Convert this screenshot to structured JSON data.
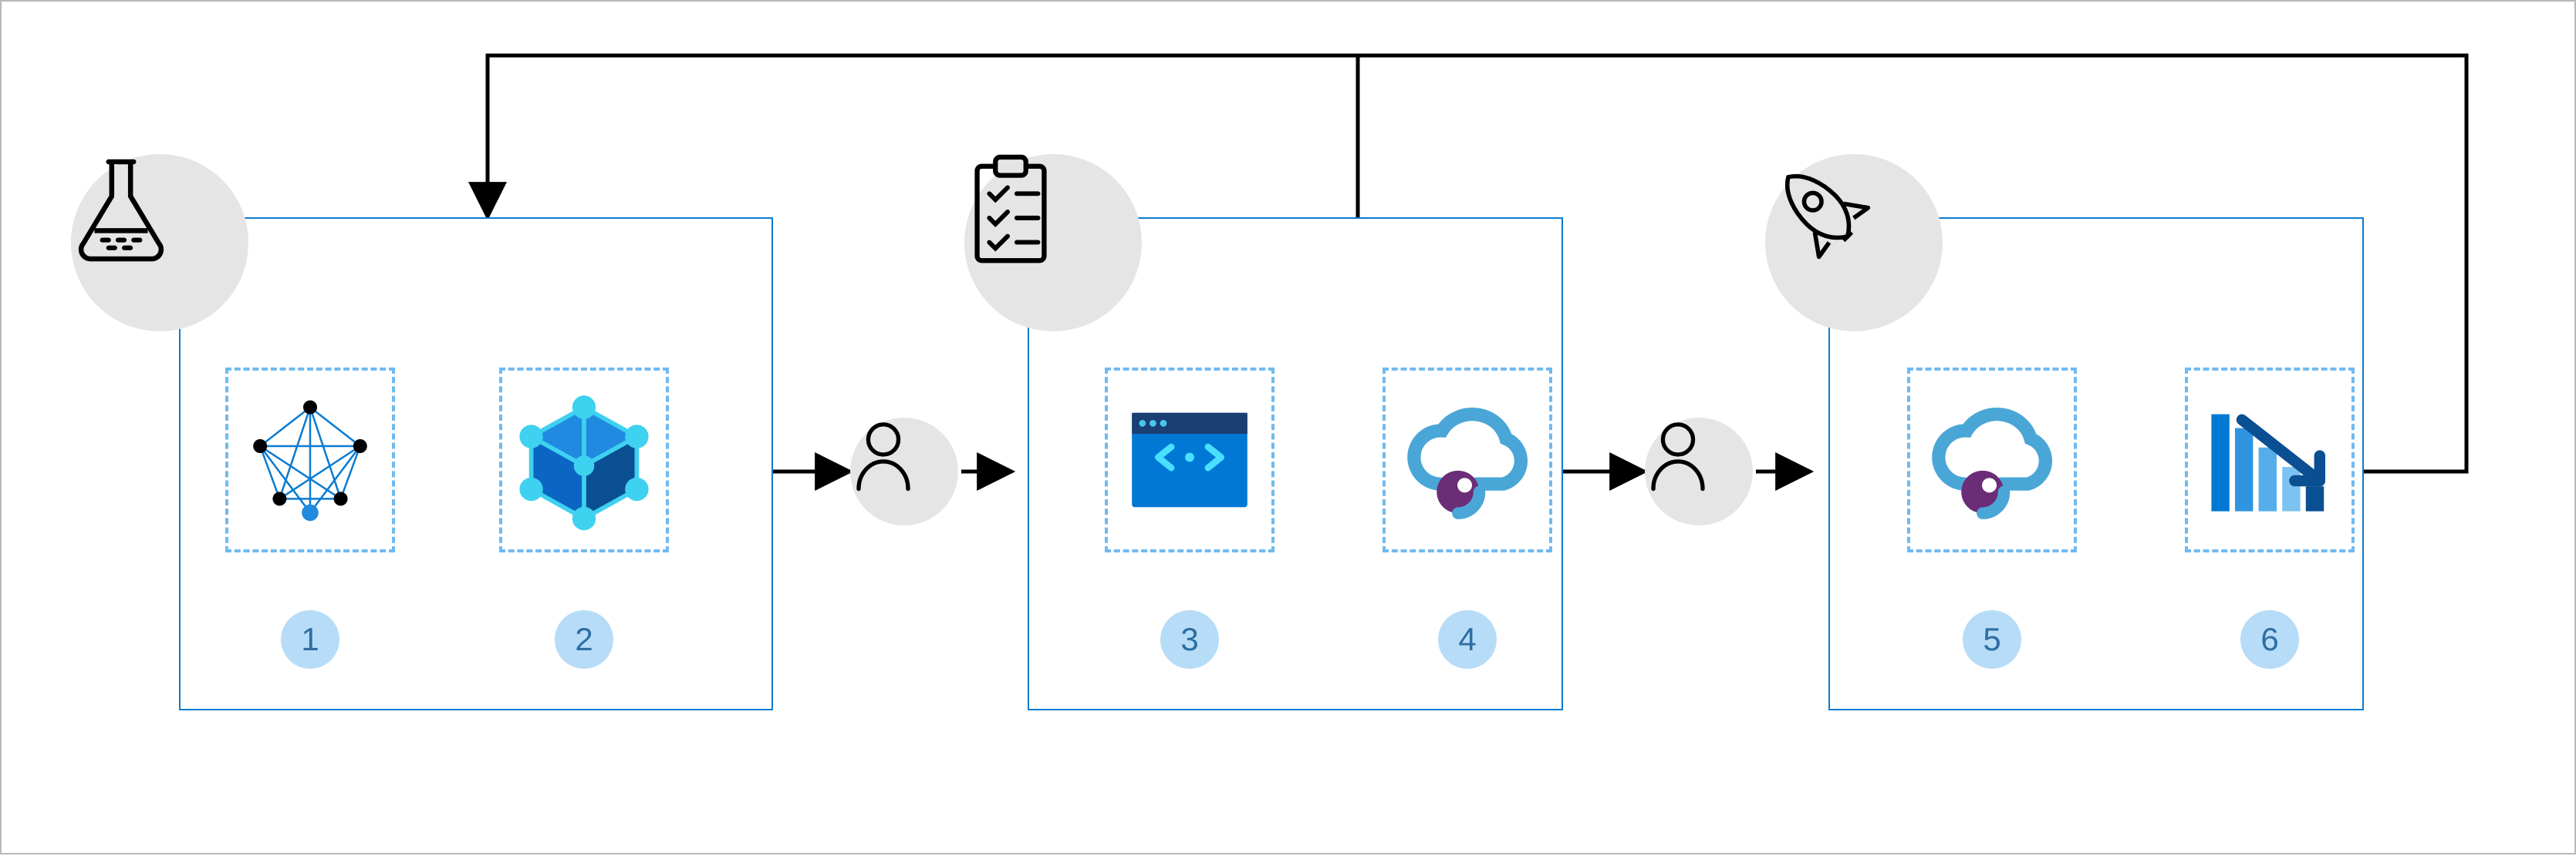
{
  "diagram": {
    "type": "mlops-pipeline",
    "stages": [
      {
        "id": "experiment",
        "badge_icon": "flask",
        "steps": [
          {
            "num": "1",
            "icon": "neural-network"
          },
          {
            "num": "2",
            "icon": "3d-cube-model"
          }
        ]
      },
      {
        "id": "evaluate",
        "badge_icon": "clipboard-checklist",
        "steps": [
          {
            "num": "3",
            "icon": "code-window"
          },
          {
            "num": "4",
            "icon": "cloud-point"
          }
        ]
      },
      {
        "id": "deploy",
        "badge_icon": "rocket",
        "steps": [
          {
            "num": "5",
            "icon": "cloud-point"
          },
          {
            "num": "6",
            "icon": "bar-chart-decline"
          }
        ]
      }
    ],
    "gates": [
      {
        "icon": "person",
        "between": [
          "experiment",
          "evaluate"
        ]
      },
      {
        "icon": "person",
        "between": [
          "evaluate",
          "deploy"
        ]
      }
    ],
    "feedback_arrows": [
      {
        "from": "step6",
        "to": "stage-experiment"
      },
      {
        "from": "step4",
        "to": "stage-experiment"
      },
      {
        "from": "step2",
        "to": "step1"
      }
    ],
    "step_labels": {
      "1": "1",
      "2": "2",
      "3": "3",
      "4": "4",
      "5": "5",
      "6": "6"
    }
  },
  "colors": {
    "stage_border": "#0b7bd1",
    "dashed_border": "#6fbaf0",
    "badge_bg": "#e5e5e5",
    "num_bg": "#b7dcf7",
    "num_fg": "#2d6ea3",
    "line": "#000000",
    "azure_blue": "#0078d4",
    "azure_cyan": "#3ed1f0",
    "azure_navy": "#1b3e73",
    "purple": "#6b2d77"
  }
}
